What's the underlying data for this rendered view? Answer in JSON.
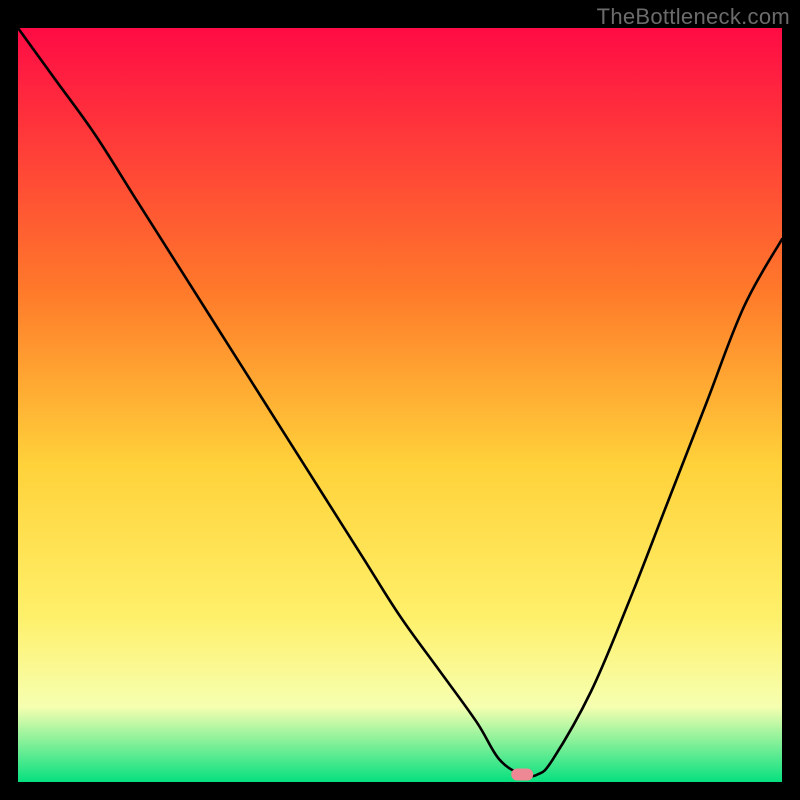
{
  "watermark": "TheBottleneck.com",
  "chart_data": {
    "type": "line",
    "title": "",
    "xlabel": "",
    "ylabel": "",
    "xlim": [
      0,
      100
    ],
    "ylim": [
      0,
      100
    ],
    "note": "Bottleneck-style V-curve over a red→yellow→green vertical gradient; minimum near the bottom plateau around x≈64–68 with a short flat section and a small pink marker at the trough.",
    "x": [
      0,
      5,
      10,
      15,
      20,
      25,
      30,
      35,
      40,
      45,
      50,
      55,
      60,
      63,
      66,
      68,
      70,
      75,
      80,
      85,
      90,
      95,
      100
    ],
    "values": [
      100,
      93,
      86,
      78,
      70,
      62,
      54,
      46,
      38,
      30,
      22,
      15,
      8,
      3,
      1,
      1,
      3,
      12,
      24,
      37,
      50,
      63,
      72
    ],
    "marker_x": 66,
    "marker_y": 1
  },
  "gradient": {
    "top": "#ff0b45",
    "mid1": "#ff7a2a",
    "mid2": "#ffd23a",
    "mid3": "#fff06a",
    "mid4": "#f6ffb0",
    "bottom": "#06e07f"
  },
  "marker_color": "#ee8894",
  "curve_color": "#000000"
}
